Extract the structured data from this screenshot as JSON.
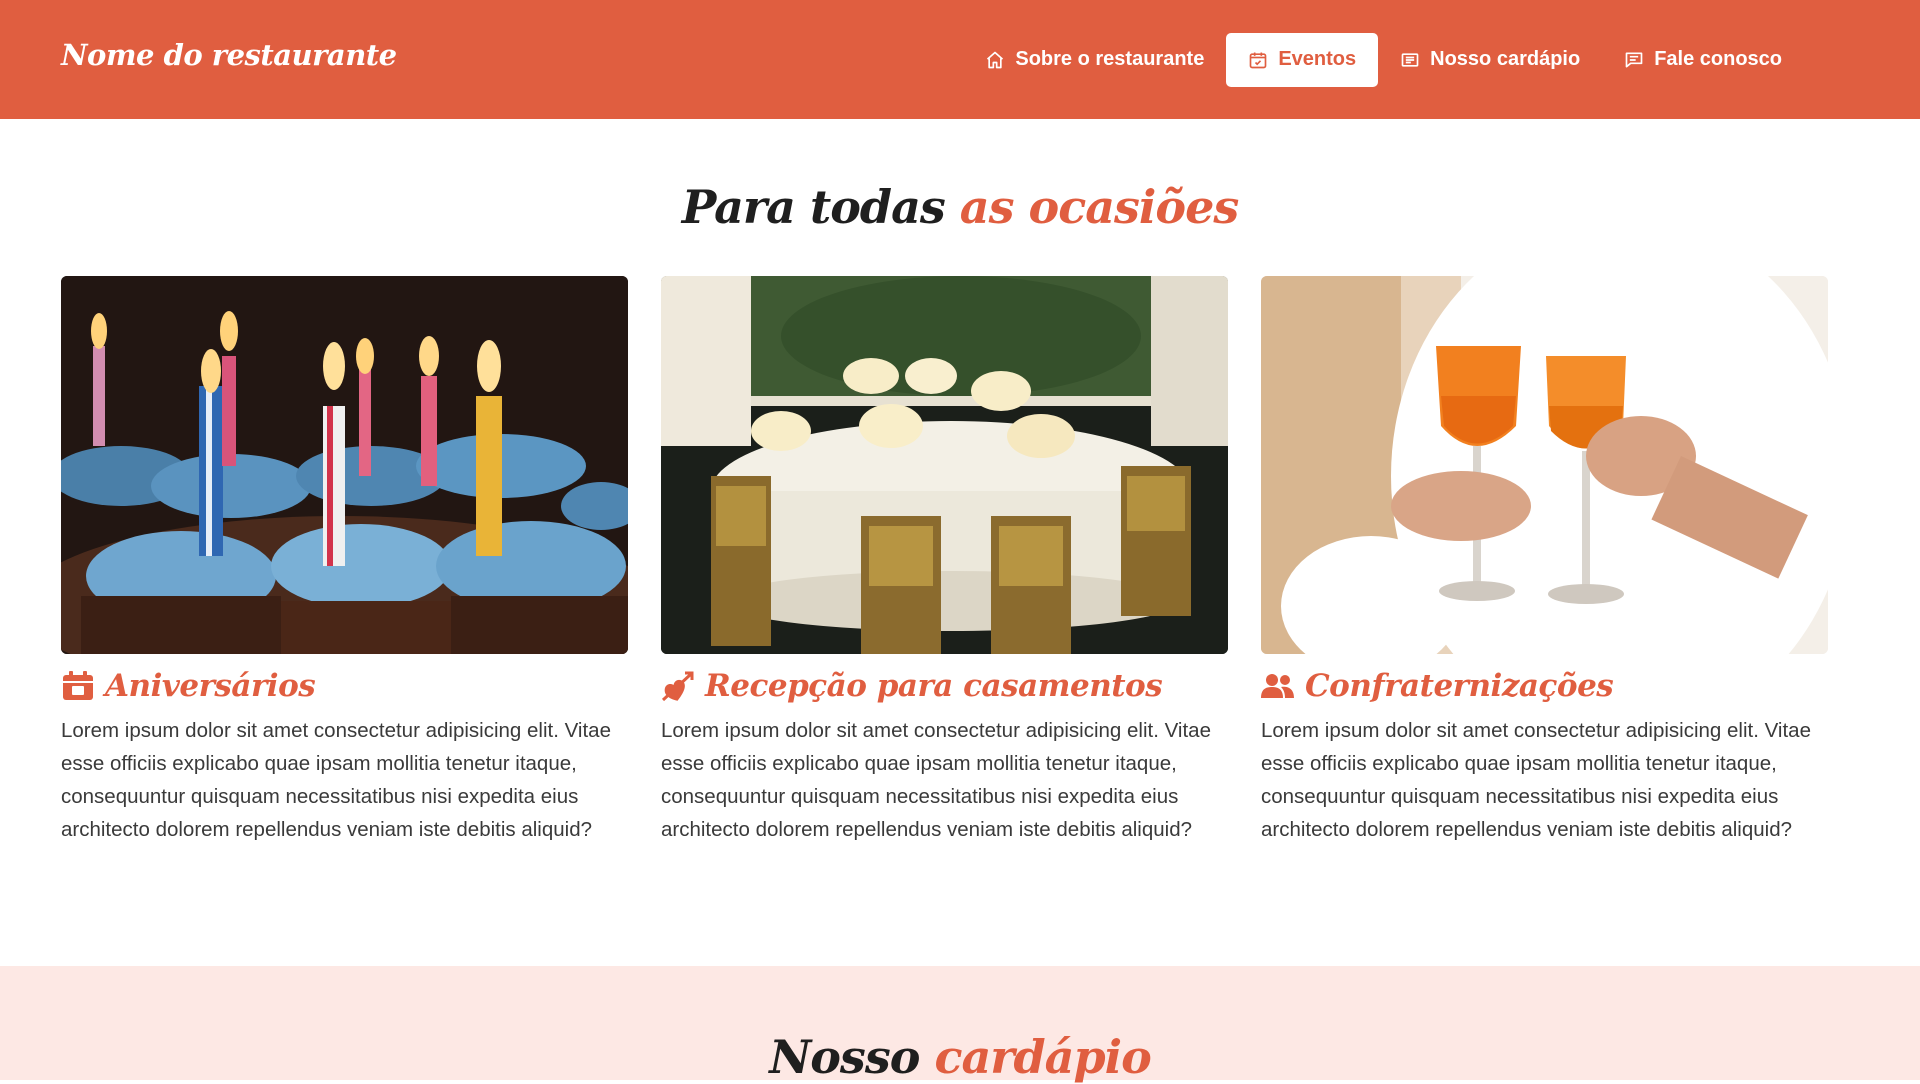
{
  "header": {
    "brand": "Nome do restaurante",
    "nav": [
      {
        "label": "Sobre o restaurante",
        "icon": "home-icon",
        "active": false
      },
      {
        "label": "Eventos",
        "icon": "calendar-check-icon",
        "active": true
      },
      {
        "label": "Nosso cardápio",
        "icon": "menu-list-icon",
        "active": false
      },
      {
        "label": "Fale conosco",
        "icon": "chat-icon",
        "active": false
      }
    ]
  },
  "events": {
    "title_part1": "Para todas",
    "title_part2": "as ocasiões",
    "cards": [
      {
        "title": "Aniversários",
        "icon": "calendar-icon",
        "image": "birthday-cupcakes-image",
        "text": "Lorem ipsum dolor sit amet consectetur adipisicing elit. Vitae esse officiis explicabo quae ipsam mollitia tenetur itaque, consequuntur quisquam necessitatibus nisi expedita eius architecto dolorem repellendus veniam iste debitis aliquid?"
      },
      {
        "title": "Recepção para casamentos",
        "icon": "heart-arrow-icon",
        "image": "wedding-table-image",
        "text": "Lorem ipsum dolor sit amet consectetur adipisicing elit. Vitae esse officiis explicabo quae ipsam mollitia tenetur itaque, consequuntur quisquam necessitatibus nisi expedita eius architecto dolorem repellendus veniam iste debitis aliquid?"
      },
      {
        "title": "Confraternizações",
        "icon": "users-icon",
        "image": "toast-glasses-image",
        "text": "Lorem ipsum dolor sit amet consectetur adipisicing elit. Vitae esse officiis explicabo quae ipsam mollitia tenetur itaque, consequuntur quisquam necessitatibus nisi expedita eius architecto dolorem repellendus veniam iste debitis aliquid?"
      }
    ]
  },
  "menu_section": {
    "title_part1": "Nosso",
    "title_part2": "cardápio"
  },
  "colors": {
    "primary": "#e05e40",
    "menu_bg": "#fde8e4",
    "text": "#3a3a3a"
  }
}
